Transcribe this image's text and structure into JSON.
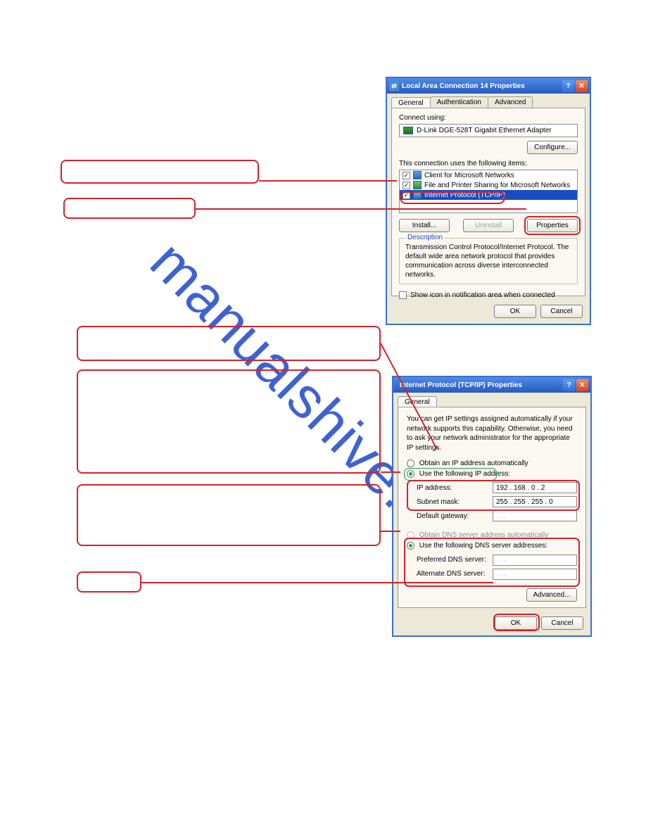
{
  "dialog1": {
    "title": "Local Area Connection 14 Properties",
    "tabs": {
      "general": "General",
      "auth": "Authentication",
      "advanced": "Advanced"
    },
    "connect_using_label": "Connect using:",
    "adapter": "D-Link DGE-528T Gigabit Ethernet Adapter",
    "configure": "Configure...",
    "items_label": "This connection uses the following items:",
    "items": [
      {
        "label": "Client for Microsoft Networks"
      },
      {
        "label": "File and Printer Sharing for Microsoft Networks"
      },
      {
        "label": "Internet Protocol (TCP/IP)"
      }
    ],
    "install": "Install...",
    "uninstall": "Uninstall",
    "properties": "Properties",
    "desc_title": "Description",
    "desc_body": "Transmission Control Protocol/Internet Protocol. The default wide area network protocol that provides communication across diverse interconnected networks.",
    "show_icon": "Show icon in notification area when connected",
    "ok": "OK",
    "cancel": "Cancel"
  },
  "dialog2": {
    "title": "Internet Protocol (TCP/IP) Properties",
    "tab_general": "General",
    "intro": "You can get IP settings assigned automatically if your network supports this capability. Otherwise, you need to ask your network administrator for the appropriate IP settings.",
    "radio_auto_ip": "Obtain an IP address automatically",
    "radio_use_ip": "Use the following IP address:",
    "ip_label": "IP address:",
    "ip_value": "192 . 168 .   0 .   2",
    "subnet_label": "Subnet mask:",
    "subnet_value": "255 . 255 . 255 .   0",
    "gateway_label": "Default gateway:",
    "gateway_value": " .       .       . ",
    "radio_auto_dns": "Obtain DNS server address automatically",
    "radio_use_dns": "Use the following DNS server addresses:",
    "pref_dns_label": "Preferred DNS server:",
    "pref_dns_value": " .       .       . ",
    "alt_dns_label": "Alternate DNS server:",
    "alt_dns_value": " .       .       . ",
    "advanced": "Advanced...",
    "ok": "OK",
    "cancel": "Cancel"
  },
  "watermark": "manualshive.com"
}
